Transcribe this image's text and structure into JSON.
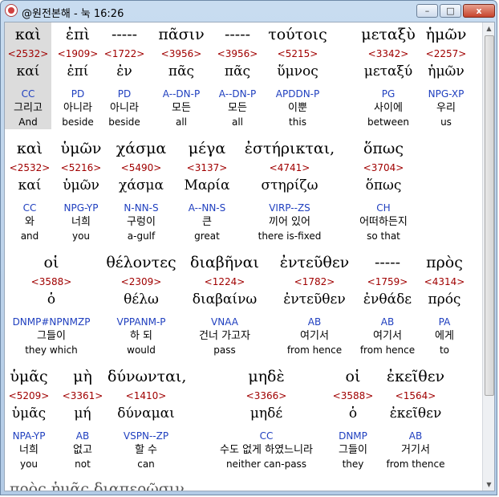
{
  "window": {
    "title": "@원전본해 - 눅 16:26",
    "buttons": {
      "minimize": "–",
      "maximize": "□",
      "close": "x"
    }
  },
  "rows": [
    [
      {
        "greek": "καὶ",
        "num": "<2532>",
        "lemma": "καί",
        "morph": "CC",
        "kor": "그리고",
        "eng": "And",
        "highlight": true
      },
      {
        "greek": "ἐπὶ",
        "num": "<1909>",
        "lemma": "ἐπί",
        "morph": "PD",
        "kor": "아니라",
        "eng": "beside"
      },
      {
        "greek": "-----",
        "num": "<1722>",
        "lemma": "ἐν",
        "morph": "PD",
        "kor": "아니라",
        "eng": "beside"
      },
      {
        "greek": "πᾶσιν",
        "num": "<3956>",
        "lemma": "πᾶς",
        "morph": "A--DN-P",
        "kor": "모든",
        "eng": "all"
      },
      {
        "greek": "-----",
        "num": "<3956>",
        "lemma": "πᾶς",
        "morph": "A--DN-P",
        "kor": "모든",
        "eng": "all"
      },
      {
        "greek": "τούτοις",
        "num": "<5215>",
        "lemma": "ὕμνος",
        "morph": "APDDN-P",
        "kor": "이뿐",
        "eng": "this"
      },
      {
        "greek": "μεταξὺ",
        "num": "<3342>",
        "lemma": "μεταξύ",
        "morph": "PG",
        "kor": "사이에",
        "eng": "between"
      },
      {
        "greek": "ἡμῶν",
        "num": "<2257>",
        "lemma": "ἡμῶν",
        "morph": "NPG-XP",
        "kor": "우리",
        "eng": "us"
      }
    ],
    [
      {
        "greek": "καὶ",
        "num": "<2532>",
        "lemma": "καί",
        "morph": "CC",
        "kor": "와",
        "eng": "and"
      },
      {
        "greek": "ὑμῶν",
        "num": "<5216>",
        "lemma": "ὑμῶν",
        "morph": "NPG-YP",
        "kor": "너희",
        "eng": "you"
      },
      {
        "greek": "χάσμα",
        "num": "<5490>",
        "lemma": "χάσμα",
        "morph": "N-NN-S",
        "kor": "구렁이",
        "eng": "a-gulf"
      },
      {
        "greek": "μέγα",
        "num": "<3137>",
        "lemma": "Μαρία",
        "morph": "A--NN-S",
        "kor": "큰",
        "eng": "great"
      },
      {
        "greek": "ἐστήρικται,",
        "num": "<4741>",
        "lemma": "στηρίζω",
        "morph": "VIRP--ZS",
        "kor": "끼어 있어",
        "eng": "there is-fixed"
      },
      {
        "greek": "ὅπως",
        "num": "<3704>",
        "lemma": "ὅπως",
        "morph": "CH",
        "kor": "어떠하든지",
        "eng": "so that"
      }
    ],
    [
      {
        "greek": "οἱ",
        "num": "<3588>",
        "lemma": "ὁ",
        "morph": "DNMP#NPNMZP",
        "kor": "그들이",
        "eng": "they which"
      },
      {
        "greek": "θέλοντες",
        "num": "<2309>",
        "lemma": "θέλω",
        "morph": "VPPANM-P",
        "kor": "하 되",
        "eng": "would"
      },
      {
        "greek": "διαβῆναι",
        "num": "<1224>",
        "lemma": "διαβαίνω",
        "morph": "VNAA",
        "kor": "건너 가고자",
        "eng": "pass"
      },
      {
        "greek": "ἐντεῦθεν",
        "num": "<1782>",
        "lemma": "ἐντεῦθεν",
        "morph": "AB",
        "kor": "여기서",
        "eng": "from hence"
      },
      {
        "greek": "-----",
        "num": "<1759>",
        "lemma": "ἐνθάδε",
        "morph": "AB",
        "kor": "여기서",
        "eng": "from hence"
      },
      {
        "greek": "πρὸς",
        "num": "<4314>",
        "lemma": "πρός",
        "morph": "PA",
        "kor": "에게",
        "eng": "to"
      }
    ],
    [
      {
        "greek": "ὑμᾶς",
        "num": "<5209>",
        "lemma": "ὑμᾶς",
        "morph": "NPA-YP",
        "kor": "너희",
        "eng": "you"
      },
      {
        "greek": "μὴ",
        "num": "<3361>",
        "lemma": "μή",
        "morph": "AB",
        "kor": "없고",
        "eng": "not"
      },
      {
        "greek": "δύνωνται,",
        "num": "<1410>",
        "lemma": "δύναμαι",
        "morph": "VSPN--ZP",
        "kor": "할 수",
        "eng": "can"
      },
      {
        "greek": "μηδὲ",
        "num": "<3366>",
        "lemma": "μηδέ",
        "morph": "CC",
        "kor": "수도 없게 하였느니라",
        "eng": "neither can-pass"
      },
      {
        "greek": "οἱ",
        "num": "<3588>",
        "lemma": "ὁ",
        "morph": "DNMP",
        "kor": "그들이",
        "eng": "they"
      },
      {
        "greek": "ἐκεῖθεν",
        "num": "<1564>",
        "lemma": "ἐκεῖθεν",
        "morph": "AB",
        "kor": "거기서",
        "eng": "from thence"
      }
    ]
  ],
  "partial_next_line": "πρὸς ἡμᾶς διαπερῶσιν."
}
